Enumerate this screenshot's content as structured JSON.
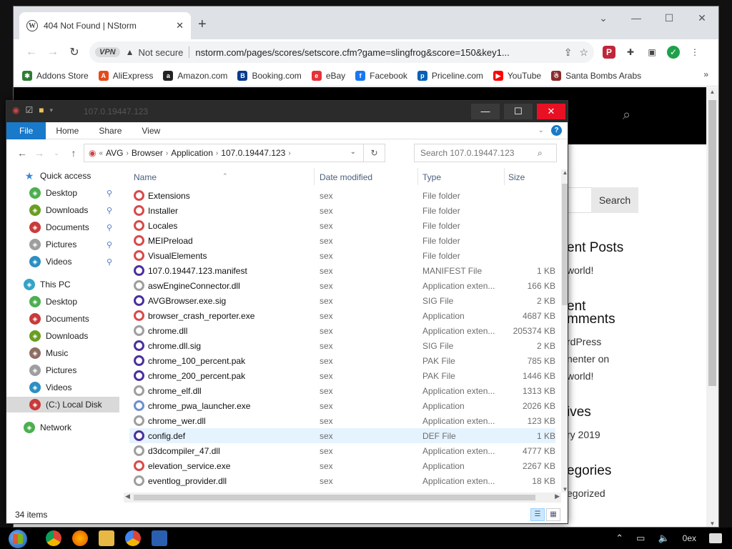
{
  "browser": {
    "tab_title": "404 Not Found | NStorm",
    "new_tab": "+",
    "vpn_badge": "VPN",
    "not_secure": "Not secure",
    "url": "nstorm.com/pages/scores/setscore.cfm?game=slingfrog&score=150&key1...",
    "bookmarks": [
      {
        "label": "Addons Store",
        "icon": "addons-icon",
        "color": "#2e7d32"
      },
      {
        "label": "AliExpress",
        "icon": "aliexpress-icon",
        "color": "#e64a19"
      },
      {
        "label": "Amazon.com",
        "icon": "amazon-icon",
        "color": "#222222"
      },
      {
        "label": "Booking.com",
        "icon": "booking-icon",
        "color": "#0b3b8c"
      },
      {
        "label": "eBay",
        "icon": "ebay-icon",
        "color": "#e53238"
      },
      {
        "label": "Facebook",
        "icon": "facebook-icon",
        "color": "#1877f2"
      },
      {
        "label": "Priceline.com",
        "icon": "priceline-icon",
        "color": "#0a5fb4"
      },
      {
        "label": "YouTube",
        "icon": "youtube-icon",
        "color": "#ff0000"
      },
      {
        "label": "Santa Bombs Arabs",
        "icon": "santa-icon",
        "color": "#8b2b2b"
      }
    ],
    "site": {
      "search_button": "Search",
      "recent_posts": "ent Posts",
      "recent_post_1": "world!",
      "recent_comments_1": "ent",
      "recent_comments_2": "mments",
      "comment_1": "rdPress",
      "comment_2": "nenter on",
      "comment_3": "world!",
      "archives": "ives",
      "archive_1": "ry 2019",
      "categories": "egories",
      "category_1": "egorized"
    }
  },
  "explorer": {
    "title": "107.0.19447.123",
    "ribbon_tabs": [
      "File",
      "Home",
      "Share",
      "View"
    ],
    "breadcrumb": [
      "AVG",
      "Browser",
      "Application",
      "107.0.19447.123"
    ],
    "search_placeholder": "Search 107.0.19447.123",
    "columns": {
      "name": "Name",
      "date": "Date modified",
      "type": "Type",
      "size": "Size"
    },
    "nav": {
      "quick_access": "Quick access",
      "qa_items": [
        "Desktop",
        "Downloads",
        "Documents",
        "Pictures",
        "Videos"
      ],
      "this_pc": "This PC",
      "pc_items": [
        "Desktop",
        "Documents",
        "Downloads",
        "Music",
        "Pictures",
        "Videos",
        "(C:) Local Disk"
      ],
      "network": "Network"
    },
    "files": [
      {
        "name": "Extensions",
        "date": "sex",
        "type": "File folder",
        "size": "",
        "icon": "folder-icon"
      },
      {
        "name": "Installer",
        "date": "sex",
        "type": "File folder",
        "size": "",
        "icon": "folder-icon"
      },
      {
        "name": "Locales",
        "date": "sex",
        "type": "File folder",
        "size": "",
        "icon": "folder-icon"
      },
      {
        "name": "MEIPreload",
        "date": "sex",
        "type": "File folder",
        "size": "",
        "icon": "folder-icon"
      },
      {
        "name": "VisualElements",
        "date": "sex",
        "type": "File folder",
        "size": "",
        "icon": "folder-icon"
      },
      {
        "name": "107.0.19447.123.manifest",
        "date": "sex",
        "type": "MANIFEST File",
        "size": "1 KB",
        "icon": "file-icon"
      },
      {
        "name": "aswEngineConnector.dll",
        "date": "sex",
        "type": "Application exten...",
        "size": "166 KB",
        "icon": "dll-icon"
      },
      {
        "name": "AVGBrowser.exe.sig",
        "date": "sex",
        "type": "SIG File",
        "size": "2 KB",
        "icon": "file-icon"
      },
      {
        "name": "browser_crash_reporter.exe",
        "date": "sex",
        "type": "Application",
        "size": "4687 KB",
        "icon": "exe-icon"
      },
      {
        "name": "chrome.dll",
        "date": "sex",
        "type": "Application exten...",
        "size": "205374 KB",
        "icon": "dll-icon"
      },
      {
        "name": "chrome.dll.sig",
        "date": "sex",
        "type": "SIG File",
        "size": "2 KB",
        "icon": "file-icon"
      },
      {
        "name": "chrome_100_percent.pak",
        "date": "sex",
        "type": "PAK File",
        "size": "785 KB",
        "icon": "file-icon"
      },
      {
        "name": "chrome_200_percent.pak",
        "date": "sex",
        "type": "PAK File",
        "size": "1446 KB",
        "icon": "file-icon"
      },
      {
        "name": "chrome_elf.dll",
        "date": "sex",
        "type": "Application exten...",
        "size": "1313 KB",
        "icon": "dll-icon"
      },
      {
        "name": "chrome_pwa_launcher.exe",
        "date": "sex",
        "type": "Application",
        "size": "2026 KB",
        "icon": "pwa-icon"
      },
      {
        "name": "chrome_wer.dll",
        "date": "sex",
        "type": "Application exten...",
        "size": "123 KB",
        "icon": "dll-icon"
      },
      {
        "name": "config.def",
        "date": "sex",
        "type": "DEF File",
        "size": "1 KB",
        "icon": "file-icon"
      },
      {
        "name": "d3dcompiler_47.dll",
        "date": "sex",
        "type": "Application exten...",
        "size": "4777 KB",
        "icon": "dll-icon"
      },
      {
        "name": "elevation_service.exe",
        "date": "sex",
        "type": "Application",
        "size": "2267 KB",
        "icon": "exe-icon"
      },
      {
        "name": "eventlog_provider.dll",
        "date": "sex",
        "type": "Application exten...",
        "size": "18 KB",
        "icon": "dll-icon"
      }
    ],
    "status_count": "34 items"
  },
  "taskbar": {
    "clock": "0ex"
  },
  "colors": {
    "folder_icon": "#d84a4a",
    "file_icon": "#4a2fa0",
    "dll_icon": "#9e9e9e",
    "exe_icon": "#d84a4a",
    "pwa_icon": "#6c8fd0",
    "accent": "#1979ca"
  }
}
